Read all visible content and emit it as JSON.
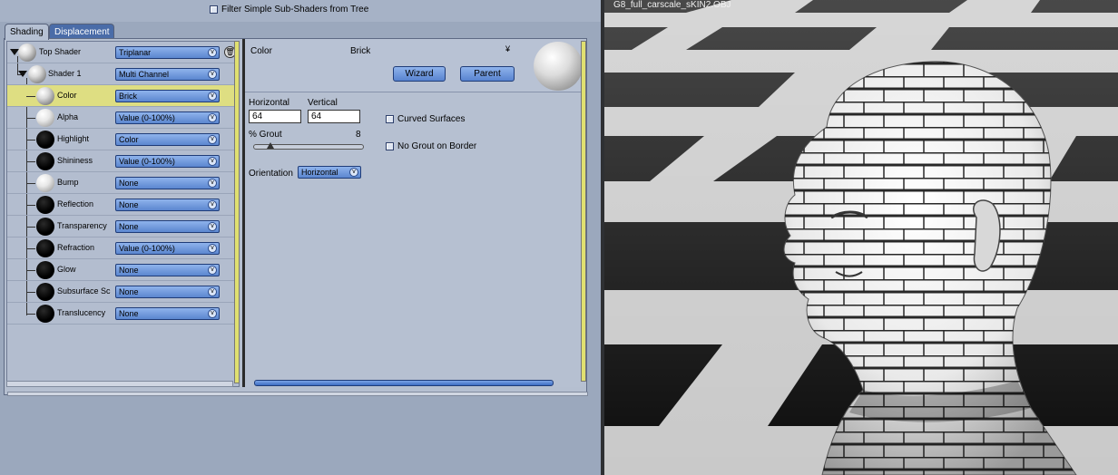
{
  "header": {
    "filter_label": "Filter Simple Sub-Shaders from Tree"
  },
  "tabs": [
    {
      "label": "Shading"
    },
    {
      "label": "Displacement"
    }
  ],
  "tree": {
    "rows": [
      {
        "label": "Top Shader",
        "value": "Triplanar"
      },
      {
        "label": "Shader 1",
        "value": "Multi Channel"
      },
      {
        "label": "Color",
        "value": "Brick"
      },
      {
        "label": "Alpha",
        "value": "Value (0-100%)"
      },
      {
        "label": "Highlight",
        "value": "Color"
      },
      {
        "label": "Shininess",
        "value": "Value (0-100%)"
      },
      {
        "label": "Bump",
        "value": "None"
      },
      {
        "label": "Reflection",
        "value": "None"
      },
      {
        "label": "Transparency",
        "value": "None"
      },
      {
        "label": "Refraction",
        "value": "Value (0-100%)"
      },
      {
        "label": "Glow",
        "value": "None"
      },
      {
        "label": "Subsurface Sc",
        "value": "None"
      },
      {
        "label": "Translucency",
        "value": "None"
      }
    ]
  },
  "props": {
    "channel_label": "Color",
    "shader_name": "Brick",
    "wizard_label": "Wizard",
    "parent_label": "Parent",
    "horizontal_label": "Horizontal",
    "horizontal_value": "64",
    "vertical_label": "Vertical",
    "vertical_value": "64",
    "grout_label": "% Grout",
    "grout_value": "8",
    "curved_label": "Curved Surfaces",
    "no_grout_label": "No Grout on Border",
    "orientation_label": "Orientation",
    "orientation_value": "Horizontal"
  },
  "viewport": {
    "title": "G8_full_carscale_sKIN2.OBJ"
  },
  "icons": {
    "dropdown": "chevron-down-icon",
    "trash": "trash-icon",
    "expand": "triangle-down-icon"
  }
}
